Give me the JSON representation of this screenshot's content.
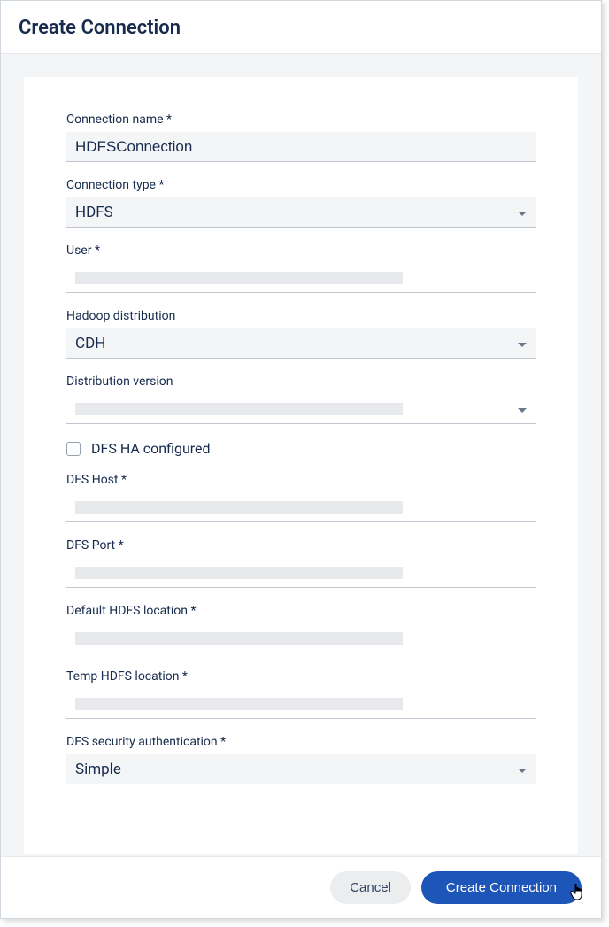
{
  "dialog": {
    "title": "Create Connection"
  },
  "fields": {
    "connection_name": {
      "label": "Connection name *",
      "value": "HDFSConnection"
    },
    "connection_type": {
      "label": "Connection type *",
      "value": "HDFS"
    },
    "user": {
      "label": "User *"
    },
    "hadoop_distribution": {
      "label": "Hadoop distribution",
      "value": "CDH"
    },
    "distribution_version": {
      "label": "Distribution version"
    },
    "dfs_ha": {
      "label": "DFS HA configured",
      "checked": false
    },
    "dfs_host": {
      "label": "DFS Host *"
    },
    "dfs_port": {
      "label": "DFS Port *"
    },
    "default_hdfs_location": {
      "label": "Default HDFS location *"
    },
    "temp_hdfs_location": {
      "label": "Temp HDFS location *"
    },
    "dfs_security_auth": {
      "label": "DFS security authentication *",
      "value": "Simple"
    }
  },
  "buttons": {
    "cancel": "Cancel",
    "create": "Create Connection"
  }
}
